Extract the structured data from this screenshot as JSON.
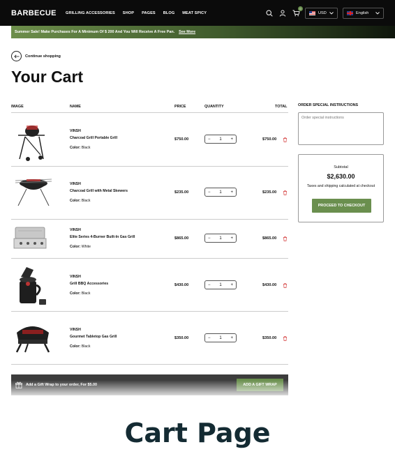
{
  "header": {
    "logo": "BARBECUE",
    "nav": [
      "GRILLING ACCESSORIES",
      "SHOP",
      "PAGES",
      "BLOG",
      "MEAT SPICY"
    ],
    "cart_count": "0",
    "currency": "USD",
    "language": "English"
  },
  "promo": {
    "text": "Summer Sale! Make Purchases For A Minimum Of $ 200 And You Will Receive A Free Pan.",
    "link": "See More"
  },
  "continue_shopping": "Continue shopping",
  "page_title": "Your Cart",
  "table": {
    "headers": {
      "image": "IMAGE",
      "name": "NAME",
      "price": "PRICE",
      "quantity": "QUANTITY",
      "total": "TOTAL"
    },
    "rows": [
      {
        "brand": "VINSH",
        "name": "Charcoal Grill Portable Grill",
        "color_label": "Color:",
        "color": "Black",
        "price": "$750.00",
        "qty": "1",
        "total": "$750.00"
      },
      {
        "brand": "VINSH",
        "name": "Charcoal Grill with Metal Skewers",
        "color_label": "Color:",
        "color": "Black",
        "price": "$235.00",
        "qty": "1",
        "total": "$235.00"
      },
      {
        "brand": "VINSH",
        "name": "Elite Series 4-Burner Built-In Gas Grill",
        "color_label": "Color:",
        "color": "White",
        "price": "$865.00",
        "qty": "1",
        "total": "$865.00"
      },
      {
        "brand": "VINSH",
        "name": "Grill BBQ Accessories",
        "color_label": "Color:",
        "color": "Black",
        "price": "$430.00",
        "qty": "1",
        "total": "$430.00"
      },
      {
        "brand": "VINSH",
        "name": "Gourmet Tabletop Gas Grill",
        "color_label": "Color:",
        "color": "Black",
        "price": "$350.00",
        "qty": "1",
        "total": "$350.00"
      }
    ]
  },
  "sidebar": {
    "instructions_label": "ORDER SPECIAL INSTRUCTIONS",
    "instructions_placeholder": "Order special instructions",
    "subtotal_label": "Subtotal",
    "subtotal": "$2,630.00",
    "tax_note": "Taxes and shipping calculated at checkout",
    "checkout_button": "PROCEED TO CHECKOUT"
  },
  "gift": {
    "text": "Add a Gift Wrap to your order, For $5.00",
    "button": "ADD A GIFT WRAP"
  },
  "caption": "Cart Page",
  "colors": {
    "accent": "#6a8f4e",
    "dark": "#0b0b0b",
    "trash": "#d43a3a"
  }
}
